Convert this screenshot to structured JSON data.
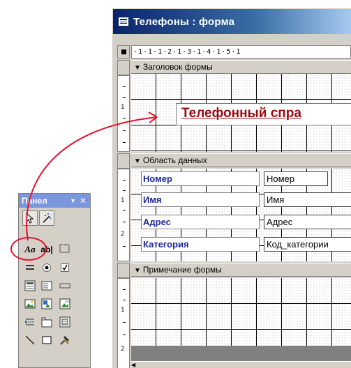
{
  "window": {
    "title": "Телефоны : форма"
  },
  "ruler": {
    "marks": "·1·1·1·2·1·3·1·4·1·5·1"
  },
  "vruler": [
    "1",
    "1",
    "2",
    "1",
    "2"
  ],
  "sections": {
    "header": "Заголовок формы",
    "detail": "Область данных",
    "footer": "Примечание формы"
  },
  "header_label": "Телефонный спра",
  "fields": [
    {
      "label": "Номер",
      "value": "Номер"
    },
    {
      "label": "Имя",
      "value": "Имя"
    },
    {
      "label": "Адрес",
      "value": "Адрес"
    },
    {
      "label": "Категория",
      "value": "Код_категории"
    }
  ],
  "toolbox": {
    "title": "Панел",
    "label_tool_text": "Aa",
    "textbox_tool_text": "ab|",
    "selected_tool": "label-tool"
  },
  "colors": {
    "title_bar": "#0a246a",
    "label_text": "#1d28a0",
    "header_text": "#9a0b0b",
    "highlight": "#e3122c"
  }
}
